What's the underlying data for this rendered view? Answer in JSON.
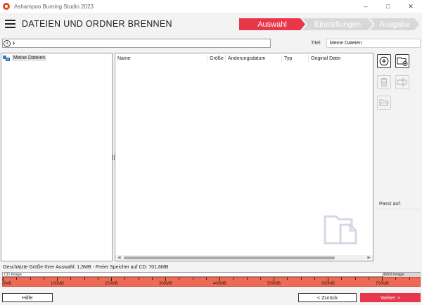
{
  "window": {
    "app_title": "Ashampoo Burning Studio 2023",
    "minimize": "–",
    "maximize": "□",
    "close": "✕"
  },
  "header": {
    "page_title": "DATEIEN UND ORDNER BRENNEN",
    "steps": [
      "Auswahl",
      "Einstellungen",
      "Ausgabe"
    ],
    "active_step": "Auswahl",
    "accent_color": "#e8364b"
  },
  "pathbar": {
    "chevron": "›"
  },
  "title_field": {
    "label": "Titel:",
    "value": "Meine Dateien"
  },
  "tree": {
    "items": [
      {
        "label": "Meine Dateien",
        "icon": "my-files-icon"
      }
    ]
  },
  "filelist": {
    "columns": [
      "Name",
      "Größe",
      "Änderungsdatum",
      "Typ",
      "Original Datei"
    ],
    "rows": []
  },
  "tools": [
    {
      "name": "add-files",
      "icon": "plus-circle-icon",
      "enabled": true
    },
    {
      "name": "add-folder",
      "icon": "folder-plus-icon",
      "enabled": true
    },
    {
      "name": "delete",
      "icon": "trash-icon",
      "enabled": false
    },
    {
      "name": "rename",
      "icon": "rename-icon",
      "enabled": false
    },
    {
      "name": "open-folder",
      "icon": "folder-open-icon",
      "enabled": false
    }
  ],
  "fit": {
    "label": "Passt auf:"
  },
  "status": {
    "text": "Geschätzte Größe Ihrer Auswahl: 1,5MB - Freier Speicher auf CD: 701,6MB"
  },
  "meter": {
    "cd_label": "CD Image",
    "dvd_label": "DVD Image",
    "scale_labels": [
      "0MB",
      "100MB",
      "200MB",
      "300MB",
      "400MB",
      "500MB",
      "600MB",
      "700MB"
    ],
    "scale_max_mb": 770,
    "dvd_start_mb": 700,
    "used_mb": 1.5,
    "bar_color": "#ef6a54"
  },
  "buttons": {
    "help": "Hilfe",
    "back": "< Zurück",
    "next": "Weiter >"
  }
}
